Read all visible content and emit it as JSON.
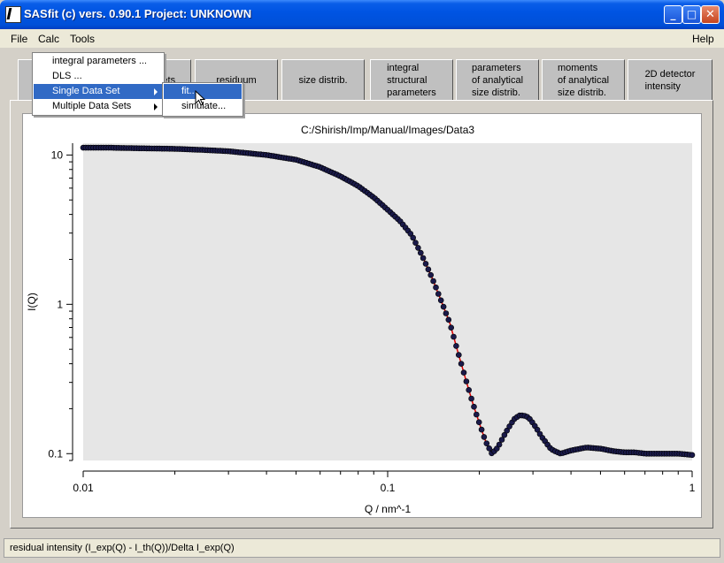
{
  "window": {
    "title": "SASfit (c) vers. 0.90.1 Project: UNKNOWN",
    "minimize": "_",
    "maximize": "□",
    "close": "✕"
  },
  "menubar": {
    "file": "File",
    "calc": "Calc",
    "tools": "Tools",
    "help": "Help"
  },
  "tabs": [
    {
      "line1": "sets",
      "line2": "",
      "line3": ""
    },
    {
      "line1": "residuum",
      "line2": "",
      "line3": ""
    },
    {
      "line1": "size distrib.",
      "line2": "",
      "line3": ""
    },
    {
      "line1": "integral",
      "line2": "structural",
      "line3": "parameters"
    },
    {
      "line1": "parameters",
      "line2": "of analytical",
      "line3": "size distrib."
    },
    {
      "line1": "moments",
      "line2": "of analytical",
      "line3": "size distrib."
    },
    {
      "line1": "2D detector",
      "line2": "intensity",
      "line3": ""
    }
  ],
  "calc_menu": {
    "items": [
      {
        "label": "integral parameters ..."
      },
      {
        "label": "DLS ..."
      },
      {
        "label": "Single Data Set"
      },
      {
        "label": "Multiple Data Sets"
      }
    ],
    "submenu": [
      {
        "label": "fit..."
      },
      {
        "label": "simulate..."
      }
    ]
  },
  "chart_data": {
    "type": "scatter",
    "title": "C:/Shirish/Imp/Manual/Images/Data3",
    "xlabel": "Q / nm^-1",
    "ylabel": "I(Q)",
    "xscale": "log",
    "yscale": "log",
    "xlim": [
      0.01,
      1
    ],
    "ylim": [
      0.09,
      12
    ],
    "xticks": [
      "0.01",
      "0.1",
      "1"
    ],
    "yticks": [
      "0.1",
      "1",
      "10"
    ],
    "colors": {
      "points": "#1a1a4a",
      "fit": "#e00000",
      "plot_bg": "#e6e6e6"
    },
    "series": [
      {
        "x": [
          0.01,
          0.012,
          0.015,
          0.02,
          0.025,
          0.03,
          0.04,
          0.05,
          0.06,
          0.07,
          0.08,
          0.09,
          0.1,
          0.11,
          0.12,
          0.13,
          0.14,
          0.15,
          0.16,
          0.17,
          0.18,
          0.19,
          0.2,
          0.21,
          0.22,
          0.23,
          0.24,
          0.25,
          0.26,
          0.27,
          0.28,
          0.29,
          0.3,
          0.31,
          0.32,
          0.33,
          0.34,
          0.35,
          0.37,
          0.4,
          0.45,
          0.5,
          0.55,
          0.6,
          0.65,
          0.7,
          0.8,
          0.9,
          1.0
        ],
        "values": [
          11.2,
          11.2,
          11.1,
          11.0,
          10.8,
          10.6,
          10.0,
          9.3,
          8.3,
          7.2,
          6.2,
          5.2,
          4.3,
          3.6,
          2.9,
          2.1,
          1.5,
          1.05,
          0.75,
          0.48,
          0.32,
          0.22,
          0.16,
          0.12,
          0.1,
          0.11,
          0.13,
          0.15,
          0.17,
          0.18,
          0.18,
          0.175,
          0.16,
          0.145,
          0.13,
          0.12,
          0.11,
          0.105,
          0.1,
          0.105,
          0.11,
          0.108,
          0.104,
          0.102,
          0.102,
          0.1,
          0.1,
          0.1,
          0.098
        ]
      }
    ]
  },
  "status": {
    "text": "residual intensity (I_exp(Q) - I_th(Q))/Delta I_exp(Q)"
  }
}
